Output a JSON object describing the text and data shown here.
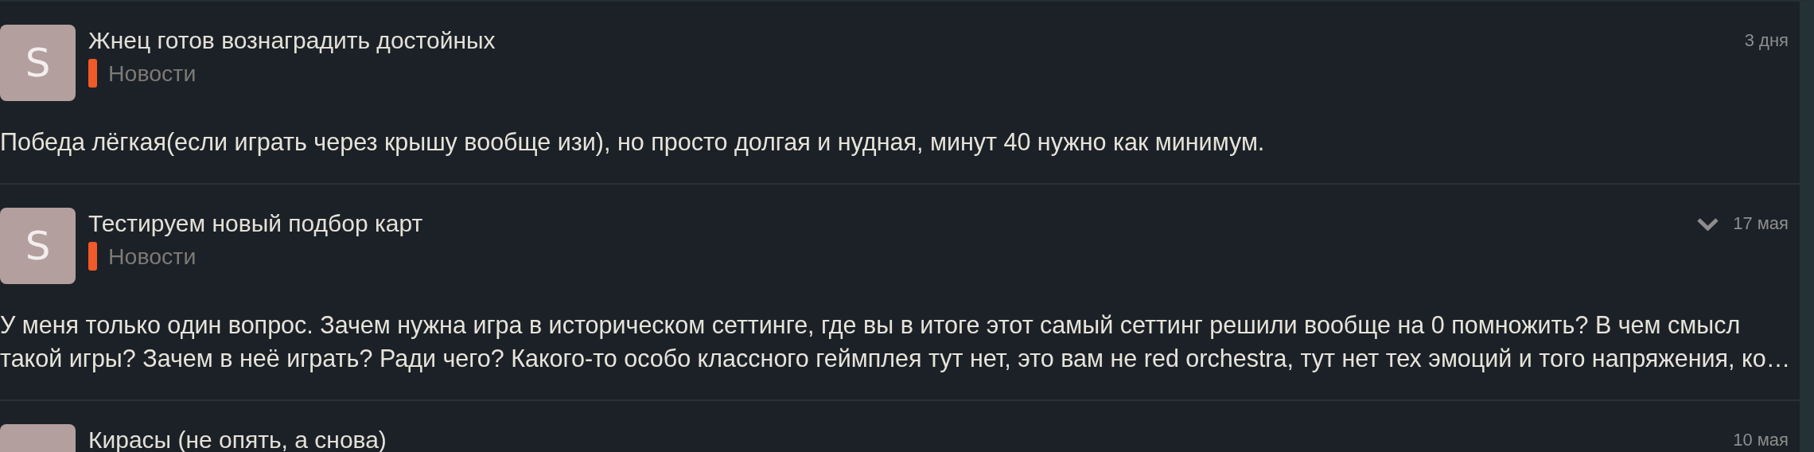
{
  "posts": [
    {
      "avatar_letter": "S",
      "title": "Жнец готов вознаградить достойных",
      "category": "Новости",
      "date": "3 дня",
      "show_chevron": false,
      "body_lines": [
        "Победа лёгкая(если играть через крышу вообще изи), но просто долгая и нудная, минут 40 нужно как минимум."
      ]
    },
    {
      "avatar_letter": "S",
      "title": "Тестируем новый подбор карт",
      "category": "Новости",
      "date": "17 мая",
      "show_chevron": true,
      "body_lines": [
        "У меня только один вопрос. Зачем нужна игра в историческом сеттинге, где вы в итоге этот самый сеттинг решили вообще на 0 помножить? В чем смысл",
        "такой игры? Зачем в неё играть? Ради чего? Какого-то особо классного геймплея тут нет, это вам не red orchestra, тут нет тех эмоций и того напряжения, ко…"
      ]
    },
    {
      "title": "Кирасы (не опять, а снова)",
      "date": "10 мая",
      "show_chevron": false
    }
  ]
}
